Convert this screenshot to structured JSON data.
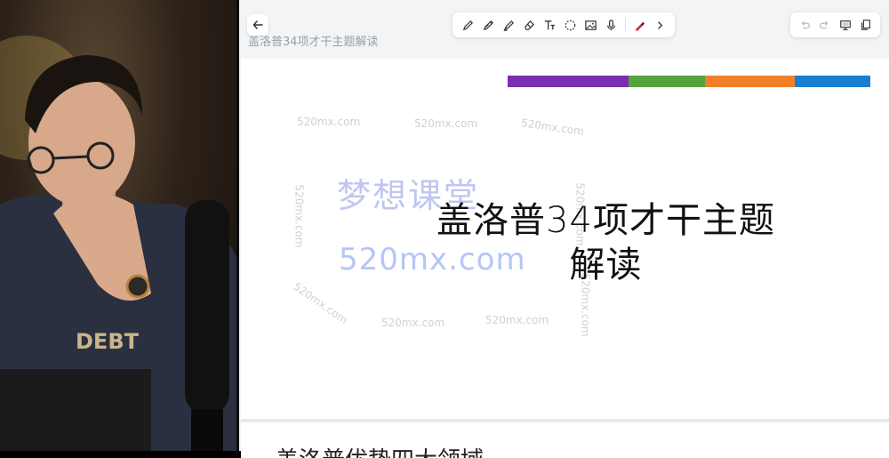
{
  "webcam": {
    "icon": "presenter-video"
  },
  "header": {
    "back_icon": "arrow-left-icon",
    "doc_title": "盖洛普34项才干主题解读"
  },
  "toolbar": {
    "tools": [
      {
        "name": "pencil"
      },
      {
        "name": "pen"
      },
      {
        "name": "highlighter"
      },
      {
        "name": "eraser"
      },
      {
        "name": "text"
      },
      {
        "name": "lasso"
      },
      {
        "name": "image"
      },
      {
        "name": "microphone"
      },
      {
        "name": "color-picker"
      },
      {
        "name": "more"
      }
    ]
  },
  "right_controls": [
    {
      "name": "undo"
    },
    {
      "name": "redo"
    },
    {
      "name": "present"
    },
    {
      "name": "copy"
    }
  ],
  "slide": {
    "title_line1": "盖洛普34项才干主题",
    "title_line2": "解读",
    "color_bar": {
      "colors": [
        "#7b2fb0",
        "#55a33c",
        "#f0802a",
        "#1a7ed0"
      ]
    }
  },
  "watermarks": {
    "small": "520mx.com",
    "cn": "梦想课堂",
    "big": "520mx.com"
  },
  "next_slide": {
    "text": "盖洛普优势四大领域"
  }
}
